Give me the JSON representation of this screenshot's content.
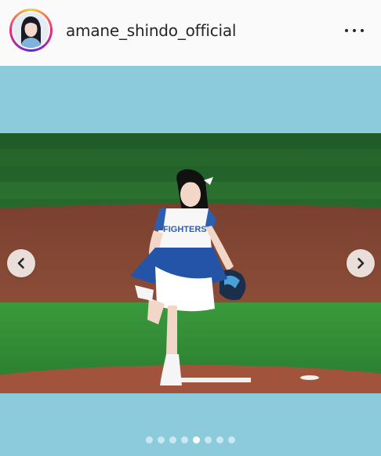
{
  "post": {
    "username": "amane_shindo_official",
    "avatar_icon": "profile-photo",
    "more_icon": "more-horizontal-icon"
  },
  "carousel": {
    "prev_icon": "chevron-left-icon",
    "next_icon": "chevron-right-icon",
    "slide_count": 8,
    "active_index": 4
  },
  "photo": {
    "jersey_text": "FIGHTERS"
  },
  "colors": {
    "background": "#8ccbdb",
    "header": "#fafafa",
    "username": "#262626"
  }
}
